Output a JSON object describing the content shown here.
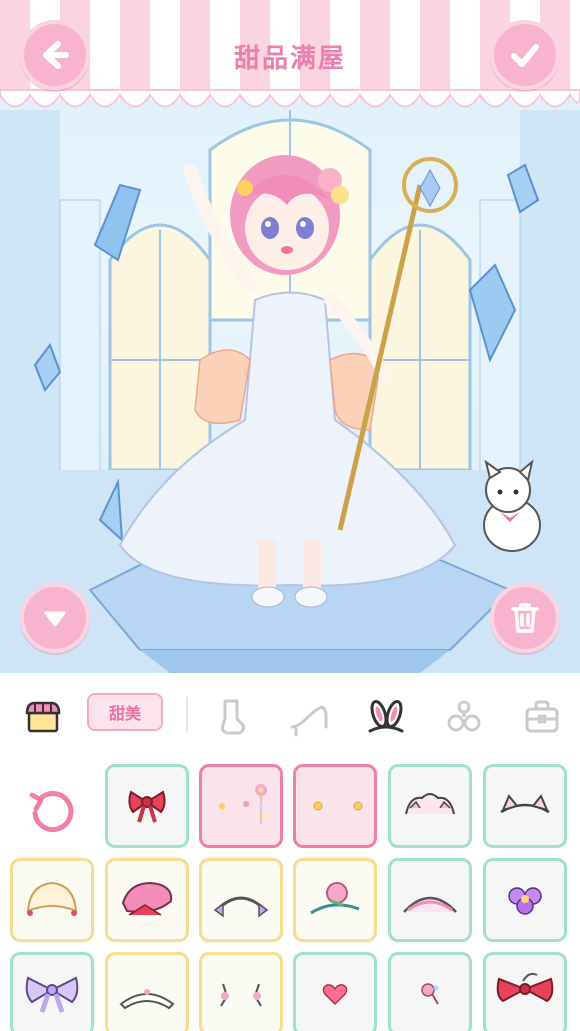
{
  "header": {
    "title": "甜品满屋"
  },
  "toolbar": {
    "style_chip": "甜美"
  },
  "categories": [
    {
      "icon": "shop-icon"
    },
    {
      "icon": "sock-icon"
    },
    {
      "icon": "heel-shoe-icon"
    },
    {
      "icon": "bunny-ears-icon",
      "selected": true
    },
    {
      "icon": "flower-accessory-icon"
    },
    {
      "icon": "bag-icon"
    }
  ],
  "items": [
    {
      "icon": "red-bow-icon",
      "state": "normal"
    },
    {
      "icon": "flower-hairpin-icon",
      "state": "selected"
    },
    {
      "icon": "yellow-dots-icon",
      "state": "selected"
    },
    {
      "icon": "lace-headband-icon",
      "state": "normal"
    },
    {
      "icon": "cat-ear-headband-icon",
      "state": "normal"
    },
    {
      "icon": "cream-bonnet-icon",
      "state": "gold"
    },
    {
      "icon": "pink-beret-icon",
      "state": "gold"
    },
    {
      "icon": "bow-headband-icon",
      "state": "gold"
    },
    {
      "icon": "rose-headband-icon",
      "state": "gold"
    },
    {
      "icon": "pink-lace-headband-icon",
      "state": "normal"
    },
    {
      "icon": "purple-flower-icon",
      "state": "normal"
    },
    {
      "icon": "lavender-bow-icon",
      "state": "normal"
    },
    {
      "icon": "white-tiara-icon",
      "state": "gold"
    },
    {
      "icon": "pink-clips-icon",
      "state": "gold"
    },
    {
      "icon": "heart-pin-icon",
      "state": "normal"
    },
    {
      "icon": "lollipop-pin-icon",
      "state": "normal"
    },
    {
      "icon": "red-ribbon-icon",
      "state": "normal"
    }
  ],
  "colors": {
    "accent_pink": "#f8b4cf",
    "title_pink": "#ec7fae",
    "tile_mint": "#9fe0cf",
    "tile_selected": "#f07eaa",
    "tile_gold": "#f6dc8e"
  }
}
